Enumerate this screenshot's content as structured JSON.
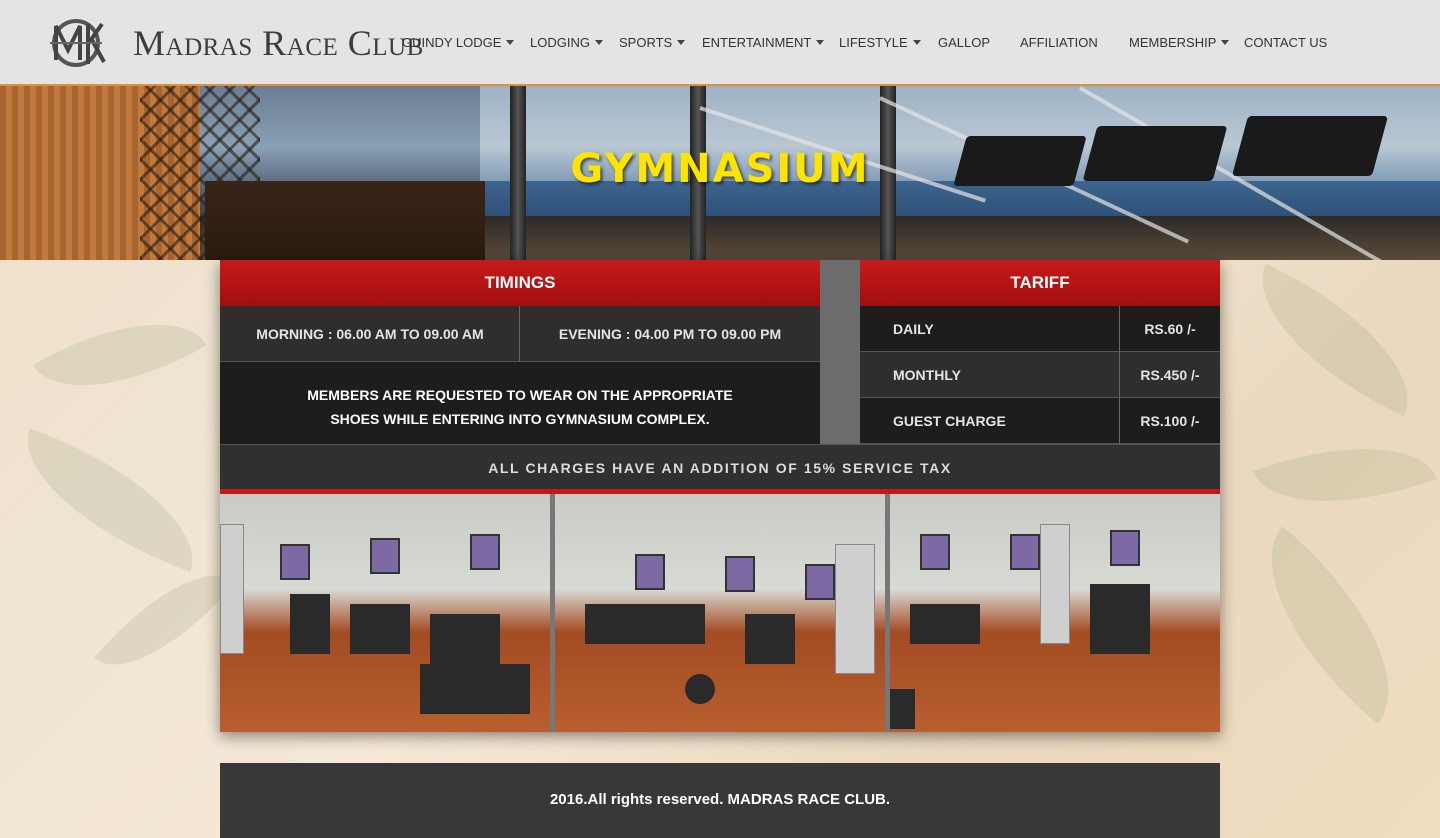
{
  "brand": {
    "name": "Madras Race Club",
    "logo_icon": "mrc-monogram-icon"
  },
  "nav": [
    {
      "label": "GUINDY LODGE",
      "has_dropdown": true
    },
    {
      "label": "LODGING",
      "has_dropdown": true
    },
    {
      "label": "SPORTS",
      "has_dropdown": true
    },
    {
      "label": "ENTERTAINMENT",
      "has_dropdown": true
    },
    {
      "label": "LIFESTYLE",
      "has_dropdown": true
    },
    {
      "label": "GALLOP",
      "has_dropdown": false
    },
    {
      "label": "AFFILIATION",
      "has_dropdown": false
    },
    {
      "label": "MEMBERSHIP",
      "has_dropdown": true
    },
    {
      "label": "CONTACT US",
      "has_dropdown": false
    }
  ],
  "hero": {
    "title": "GYMNASIUM"
  },
  "timings": {
    "heading": "TIMINGS",
    "morning": "MORNING : 06.00 AM TO 09.00 AM",
    "evening": "EVENING : 04.00 PM TO 09.00 PM",
    "note_line1": "MEMBERS ARE REQUESTED TO WEAR ON THE APPROPRIATE",
    "note_line2": "SHOES WHILE ENTERING INTO GYMNASIUM COMPLEX."
  },
  "tariff": {
    "heading": "TARIFF",
    "rows": [
      {
        "label": "DAILY",
        "price": "RS.60 /-"
      },
      {
        "label": "MONTHLY",
        "price": "RS.450 /-"
      },
      {
        "label": "GUEST CHARGE",
        "price": "RS.100 /-"
      }
    ]
  },
  "tax_note": "ALL CHARGES HAVE AN ADDITION OF 15% SERVICE TAX",
  "footer": {
    "text": "2016.All rights reserved. MADRAS RACE CLUB."
  },
  "colors": {
    "accent_red": "#c51b1b",
    "title_yellow": "#ffe400",
    "header_border": "#d9923e"
  }
}
